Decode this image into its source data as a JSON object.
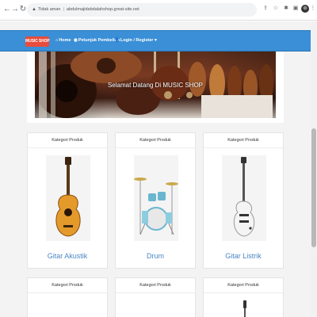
{
  "browser": {
    "security_label": "Tidak aman",
    "url": "abdulmajidabdalahshop.great-site.net",
    "icons": [
      "back-icon",
      "forward-icon",
      "reload-icon",
      "lock-icon",
      "share-icon",
      "star-icon",
      "extension-icon",
      "puzzle-icon",
      "sidebar-icon",
      "profile-avatar",
      "menu-icon"
    ]
  },
  "navbar": {
    "brand": "MUSIC SHOP",
    "items": [
      {
        "label": "Home",
        "icon": "home-icon"
      },
      {
        "label": "Petunjuk Pembelian",
        "icon": "pin-icon"
      },
      {
        "label": "Login / Register",
        "icon": "user-icon"
      }
    ],
    "colors": {
      "bar": "#3a8fd6",
      "brand": "#e74c3c"
    }
  },
  "banner": {
    "title": "Selamat Datang Di MUSIC SHOP"
  },
  "cards": [
    {
      "header": "Kategori Produk",
      "title": "Gitar Akustik",
      "image": "acoustic-guitar"
    },
    {
      "header": "Kategori Produk",
      "title": "Drum",
      "image": "drum-kit"
    },
    {
      "header": "Kategori Produk",
      "title": "Gitar Listrik",
      "image": "electric-guitar"
    },
    {
      "header": "Kategori Produk",
      "title": "",
      "image": ""
    },
    {
      "header": "Kategori Produk",
      "title": "",
      "image": ""
    },
    {
      "header": "Kategori Produk",
      "title": "",
      "image": "guitar-headstock"
    }
  ],
  "colors": {
    "link": "#4a86c5",
    "page_bg": "#f3f3f3"
  }
}
